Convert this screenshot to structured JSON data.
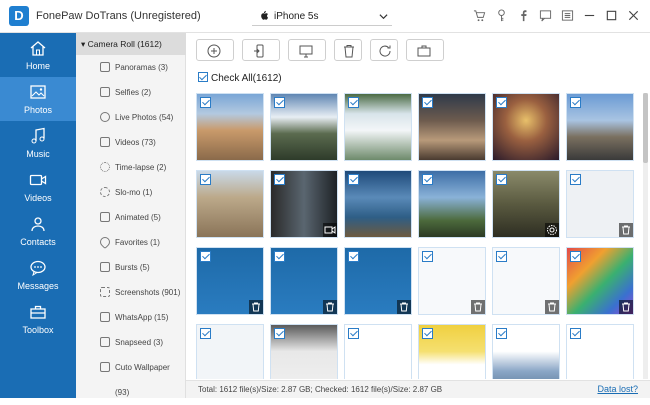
{
  "app": {
    "title": "FonePaw DoTrans (Unregistered)",
    "logo_letter": "D"
  },
  "device": {
    "name": "iPhone 5s"
  },
  "sidebar": {
    "items": [
      {
        "label": "Home",
        "icon": "home-icon"
      },
      {
        "label": "Photos",
        "icon": "photo-icon",
        "active": true
      },
      {
        "label": "Music",
        "icon": "music-note-icon"
      },
      {
        "label": "Videos",
        "icon": "video-camera-icon"
      },
      {
        "label": "Contacts",
        "icon": "contacts-icon"
      },
      {
        "label": "Messages",
        "icon": "chat-bubble-icon"
      },
      {
        "label": "Toolbox",
        "icon": "toolbox-icon"
      }
    ]
  },
  "categories": {
    "header": "Camera Roll (1612)",
    "items": [
      "Panoramas (3)",
      "Selfies (2)",
      "Live Photos (54)",
      "Videos (73)",
      "Time-lapse (2)",
      "Slo-mo (1)",
      "Animated (5)",
      "Favorites (1)",
      "Bursts (5)",
      "Screenshots (901)",
      "WhatsApp (15)",
      "Snapseed (3)",
      "Cuto Wallpaper (93)"
    ]
  },
  "content": {
    "check_all": "Check All(1612)"
  },
  "status": {
    "summary": "Total: 1612 file(s)/Size: 2.87 GB; Checked: 1612 file(s)/Size: 2.87 GB",
    "data_lost": "Data lost?"
  },
  "colors": {
    "sidebar": "#1a6db4",
    "active": "#3a8ad2",
    "accent": "#2a7cc7"
  }
}
